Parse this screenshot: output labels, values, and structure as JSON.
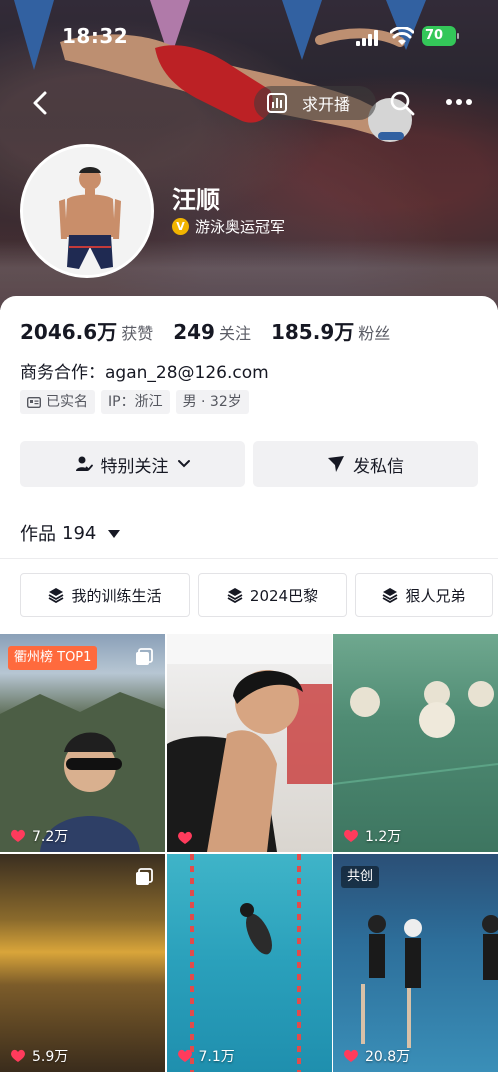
{
  "status_bar": {
    "time": "18:32",
    "battery": "70"
  },
  "header": {
    "live_label": "求开播",
    "name": "汪顺",
    "verification": "游泳奥运冠军"
  },
  "stats": [
    {
      "value": "2046.6万",
      "label": "获赞"
    },
    {
      "value": "249",
      "label": "关注"
    },
    {
      "value": "185.9万",
      "label": "粉丝"
    }
  ],
  "business": "商务合作：agan_28@126.com",
  "tags": [
    "已实名",
    "IP：浙江",
    "男 · 32岁"
  ],
  "actions": {
    "follow": "特别关注",
    "message": "发私信"
  },
  "works": {
    "label": "作品",
    "count": "194"
  },
  "collections": [
    "我的训练生活",
    "2024巴黎",
    "狠人兄弟"
  ],
  "videos": [
    {
      "likes": "7.2万",
      "badge": "衢州榜 TOP1"
    },
    {
      "likes": ""
    },
    {
      "likes": "1.2万"
    },
    {
      "likes": "5.9万"
    },
    {
      "likes": "7.1万"
    },
    {
      "likes": "20.8万",
      "badge": "共创"
    }
  ],
  "colors": {
    "accent": "#ff3b5c",
    "verify": "#f2b400",
    "battery": "#34c759",
    "rank_badge": "#ff6a3d"
  }
}
